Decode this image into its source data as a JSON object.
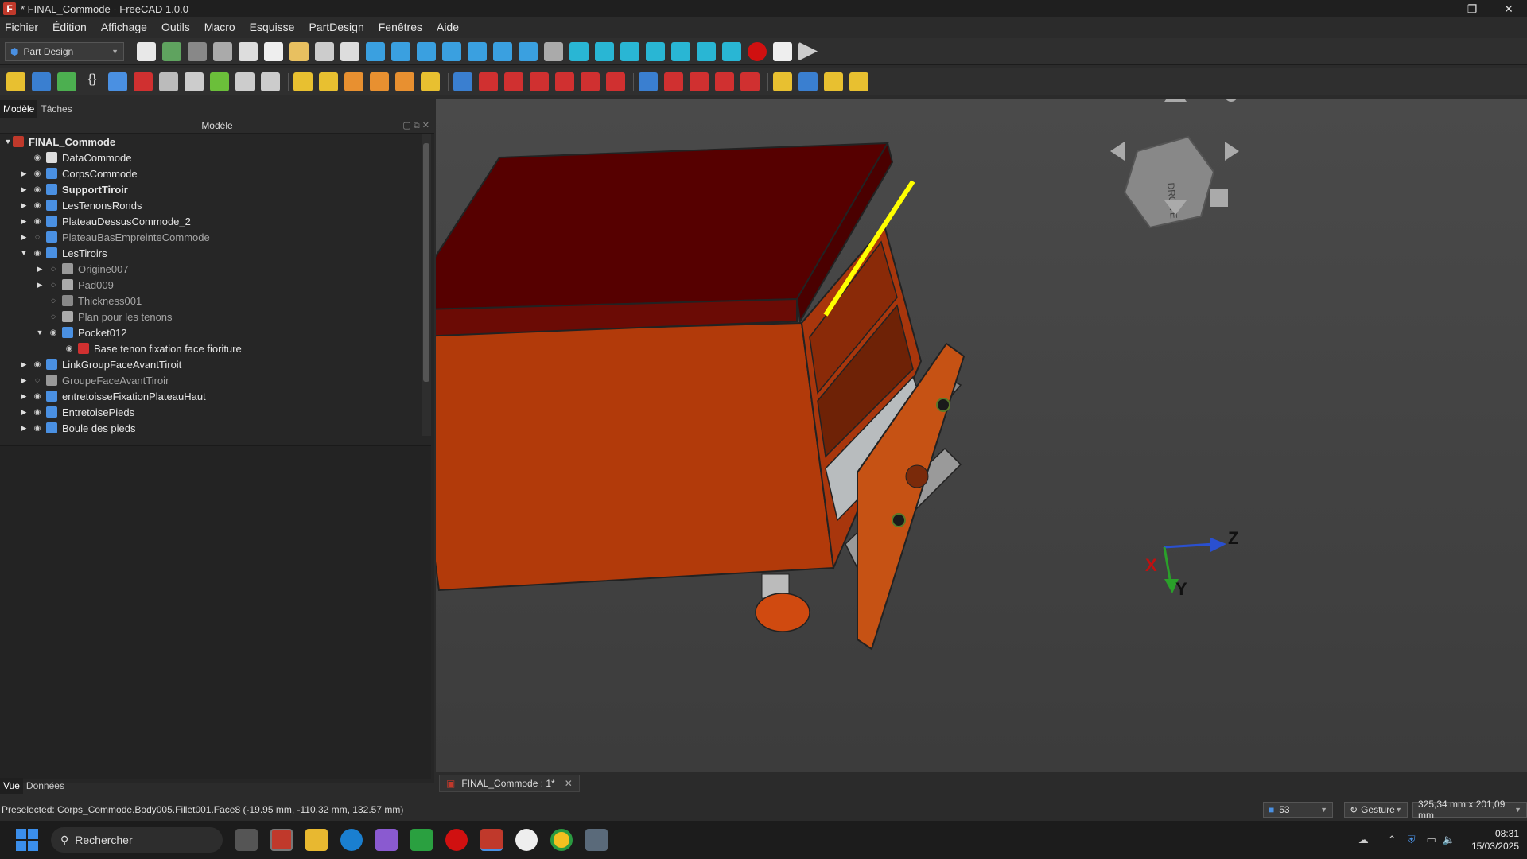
{
  "window": {
    "title": "* FINAL_Commode - FreeCAD 1.0.0",
    "icon": "freecad-icon"
  },
  "menu": [
    "Fichier",
    "Édition",
    "Affichage",
    "Outils",
    "Macro",
    "Esquisse",
    "PartDesign",
    "Fenêtres",
    "Aide"
  ],
  "workbench": {
    "selected": "Part Design"
  },
  "panel": {
    "tabs": [
      "Modèle",
      "Tâches"
    ],
    "tree_title": "Modèle",
    "bottom_tabs": [
      "Vue",
      "Données"
    ]
  },
  "tree": [
    {
      "label": "FINAL_Commode",
      "level": 0,
      "expanded": true,
      "bold": true,
      "icon": "document-icon"
    },
    {
      "label": "DataCommode",
      "level": 1,
      "icon": "spreadsheet-icon"
    },
    {
      "label": "CorpsCommode",
      "level": 1,
      "collapsed": true,
      "icon": "body-icon"
    },
    {
      "label": "SupportTiroir",
      "level": 1,
      "collapsed": true,
      "bold": true,
      "icon": "body-icon"
    },
    {
      "label": "LesTenonsRonds",
      "level": 1,
      "collapsed": true,
      "icon": "body-icon"
    },
    {
      "label": "PlateauDessusCommode_2",
      "level": 1,
      "collapsed": true,
      "icon": "body-icon"
    },
    {
      "label": "PlateauBasEmpreinteCommode",
      "level": 1,
      "collapsed": true,
      "dim": true,
      "icon": "body-icon"
    },
    {
      "label": "LesTiroirs",
      "level": 1,
      "expanded": true,
      "icon": "body-icon"
    },
    {
      "label": "Origine007",
      "level": 2,
      "collapsed": true,
      "dim": true,
      "icon": "origin-icon"
    },
    {
      "label": "Pad009",
      "level": 2,
      "collapsed": true,
      "dim": true,
      "icon": "pad-icon"
    },
    {
      "label": "Thickness001",
      "level": 2,
      "dim": true,
      "icon": "thickness-icon"
    },
    {
      "label": "Plan pour les tenons",
      "level": 2,
      "dim": true,
      "icon": "plane-icon"
    },
    {
      "label": "Pocket012",
      "level": 2,
      "expanded": true,
      "icon": "pocket-icon"
    },
    {
      "label": "Base tenon fixation face fioriture",
      "level": 3,
      "icon": "sketch-icon"
    },
    {
      "label": "LinkGroupFaceAvantTiroit",
      "level": 1,
      "collapsed": true,
      "icon": "linkgroup-icon"
    },
    {
      "label": "GroupeFaceAvantTiroir",
      "level": 1,
      "collapsed": true,
      "dim": true,
      "icon": "group-icon"
    },
    {
      "label": "entretoisseFixationPlateauHaut",
      "level": 1,
      "collapsed": true,
      "icon": "body-icon"
    },
    {
      "label": "EntretoisePieds",
      "level": 1,
      "collapsed": true,
      "icon": "body-icon"
    },
    {
      "label": "Boule des pieds",
      "level": 1,
      "collapsed": true,
      "icon": "body-icon"
    }
  ],
  "viewport": {
    "navcube_face": "DROITE",
    "axes": {
      "x": "X",
      "y": "Y",
      "z": "Z"
    }
  },
  "doc_tab": {
    "label": "FINAL_Commode : 1*"
  },
  "status": {
    "message": "Preselected: Corps_Commode.Body005.Fillet001.Face8 (-19.95 mm, -110.32 mm, 132.57 mm)",
    "count": "53",
    "nav_style": "Gesture",
    "dimensions": "325,34 mm x 201,09 mm"
  },
  "taskbar": {
    "search": "Rechercher",
    "time": "08:31",
    "date": "15/03/2025"
  },
  "colors": {
    "body": "#b33a0c",
    "top": "#5a0000",
    "highlight": "#ffff00",
    "grey": "#9a9a9a"
  }
}
